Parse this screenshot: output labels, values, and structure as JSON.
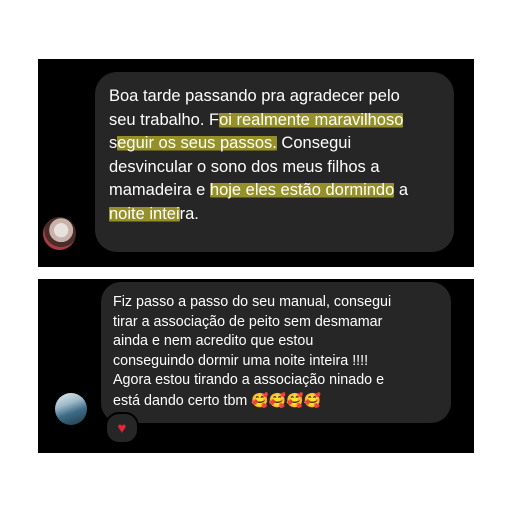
{
  "message1": {
    "lines": [
      {
        "segments": [
          {
            "text": "Boa tarde passando pra agradecer pelo"
          }
        ]
      },
      {
        "segments": [
          {
            "text": "seu trabalho. F"
          },
          {
            "text": "oi realmente maravilhoso",
            "hl": true
          }
        ]
      },
      {
        "segments": [
          {
            "text": "s"
          },
          {
            "text": "eguir os seus passos.",
            "hl": true
          },
          {
            "text": " Consegui"
          }
        ]
      },
      {
        "segments": [
          {
            "text": "desvincular o sono dos meus filhos a"
          }
        ]
      },
      {
        "segments": [
          {
            "text": "mamadeira e "
          },
          {
            "text": "hoje eles estão dormindo",
            "hl": true
          },
          {
            "text": " a"
          }
        ]
      },
      {
        "segments": [
          {
            "text": "noite intei",
            "hl": true
          },
          {
            "text": "ra."
          }
        ]
      }
    ]
  },
  "message2": {
    "lines": [
      "Fiz passo a passo do seu manual, consegui",
      "tirar a associação de peito sem desmamar",
      "ainda e nem acredito que estou",
      "conseguindo dormir uma noite inteira  !!!!",
      "Agora estou tirando a associação ninado e",
      "está dando certo tbm"
    ],
    "emojis": "🥰🥰🥰🥰",
    "reaction": "♥"
  },
  "colors": {
    "panel": "#000000",
    "bubble": "#262626",
    "highlight": "#f0e828",
    "heart": "#e8233a"
  },
  "icons": [
    "avatar-user-1",
    "avatar-user-2",
    "heart-icon"
  ]
}
